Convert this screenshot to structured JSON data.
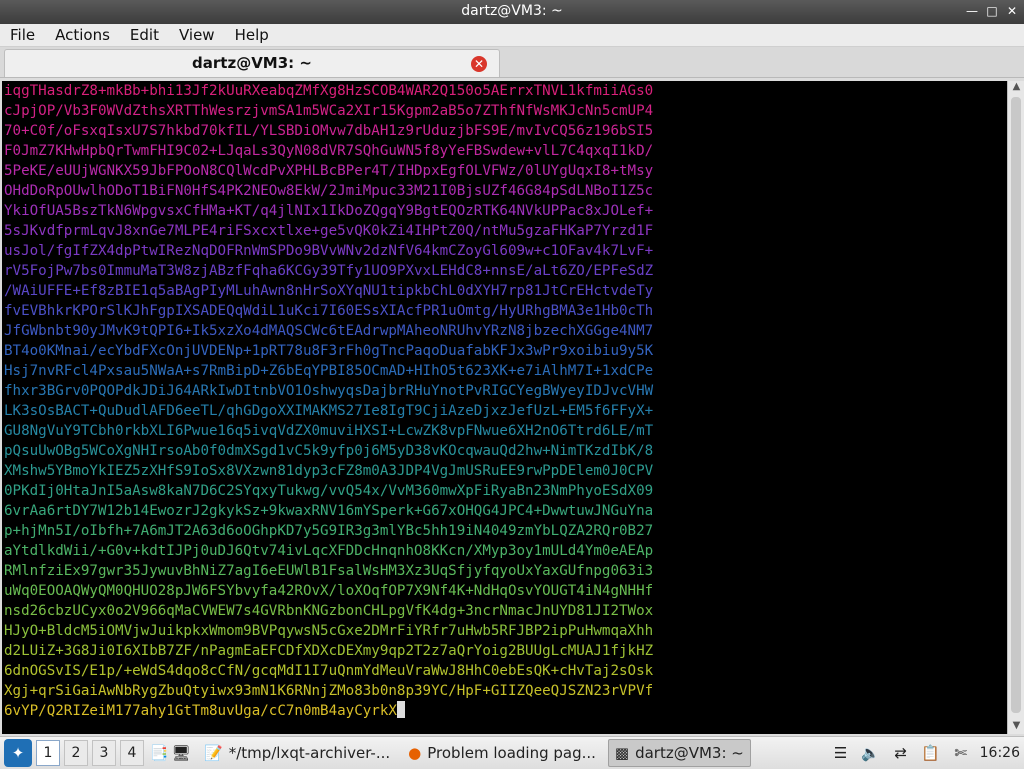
{
  "window": {
    "title": "dartz@VM3: ~"
  },
  "menu": [
    "File",
    "Actions",
    "Edit",
    "View",
    "Help"
  ],
  "tab": {
    "label": "dartz@VM3: ~"
  },
  "terminal": {
    "lines": [
      {
        "text": "iqgTHasdrZ8+mkBb+bhi13Jf2kUuRXeabqZMfXg8HzSCOB4WAR2Q150o5AErrxTNVL1kfmiiAGs0",
        "color": "#d9207a"
      },
      {
        "text": "cJpjOP/Vb3F0WVdZthsXRTThWesrzjvmSA1m5WCa2XIr15Kgpm2aB5o7ZThfNfWsMKJcNn5cmUP4",
        "color": "#d32287"
      },
      {
        "text": "70+C0f/oFsxqIsxU7S7hkbd70kfIL/YLSBDiOMvw7dbAH1z9rUduzjbFS9E/mvIvCQ56z196bSI5",
        "color": "#cc2493"
      },
      {
        "text": "F0JmZ7KHwHpbQrTwmFHI9C02+LJqaLs3QyN08dVR7SQhGuWN5f8yYeFBSwdew+vlL7C4qxqI1kD/",
        "color": "#c3279f"
      },
      {
        "text": "5PeKE/eUUjWGNKX59JbFPOoN8CQlWcdPvXPHLBcBPer4T/IHDpxEgfOLVFWz/0lUYgUqxI8+tMsy",
        "color": "#b82aaa"
      },
      {
        "text": "OHdDoRpOUwlhODoT1BiFN0HfS4PK2NEOw8EkW/2JmiMpuc33M21I0BjsUZf46G84pSdLNBoI1Z5c",
        "color": "#ab2db3"
      },
      {
        "text": "YkiOfUA5BszTkN6WpgvsxCfHMa+KT/q4jlNIx1IkDoZQgqY9BgtEQOzRTK64NVkUPPac8xJOLef+",
        "color": "#9c31bb"
      },
      {
        "text": "5sJKvdfprmLqvJ8xnGe7MLPE4riFSxcxtlxe+ge5vQK0kZi4IHPtZ0Q/ntMu5gzaFHKaP7Yrzd1F",
        "color": "#8c35c1"
      },
      {
        "text": "usJol/fgIfZX4dpPtwIRezNqDOFRnWmSPDo9BVvWNv2dzNfV64kmCZoyGl609w+c1OFav4k7LvF+",
        "color": "#7b3ac5"
      },
      {
        "text": "rV5FojPw7bs0ImmuMaT3W8zjABzfFqha6KCGy39Tfy1UO9PXvxLEHdC8+nnsE/aLt6ZO/EPFeSdZ",
        "color": "#6a40c7"
      },
      {
        "text": "/WAiUFFE+Ef8zBIE1q5aBAgPIyMLuhAwn8nHrSoXYqNU1tipkbChL0dXYH7rp81JtCrEHctvdeTy",
        "color": "#5a47c8"
      },
      {
        "text": "fvEVBhkrKPOrSlKJhFgpIXSADEQqWdiL1uKci7I60ESsXIAcfPR1uOmtg/HyURhgBMA3e1Hb0cTh",
        "color": "#4b50c7"
      },
      {
        "text": "JfGWbnbt90yJMvK9tQPI6+Ik5xzXo4dMAQSCWc6tEAdrwpMAheoNRUhvYRzN8jbzechXGGge4NM7",
        "color": "#3e59c4"
      },
      {
        "text": "BT4o0KMnai/ecYbdFXcOnjUVDENp+1pRT78u8F3rFh0gTncPaqoDuafabKFJx3wPr9xoibiu9y5K",
        "color": "#3363c0"
      },
      {
        "text": "Hsj7nvRFcl4Pxsau5NWaA+s7RmBipD+Z6bEqYPBI85OCmAD+HIhO5t623XK+e7iAlhM7I+1xdCPe",
        "color": "#2b6dba"
      },
      {
        "text": "fhxr3BGrv0PQOPdkJDiJ64ARkIwDItnbVO1OshwyqsDajbrRHuYnotPvRIGCYegBWyeyIDJvcVHW",
        "color": "#2777b3"
      },
      {
        "text": "LK3sOsBACT+QuDudlAFD6eeTL/qhGDgoXXIMAKMS27Ie8IgT9CjiAzeDjxzJefUzL+EM5f6FFyX+",
        "color": "#2580ab"
      },
      {
        "text": "GU8NgVuY9TCbh0rkbXLI6Pwue16q5ivqVdZX0muviHXSI+LcwZK8vpFNwue6XH2nO6Ttrd6LE/mT",
        "color": "#2689a3"
      },
      {
        "text": "pQsuUwOBg5WCoXgNHIrsoAb0f0dmXSgd1vC5k9yfp0j6M5yD38vKOcqwauQd2hw+NimTKzdIbK/8",
        "color": "#28929a"
      },
      {
        "text": "XMshw5YBmoYkIEZ5zXHfS9IoSx8VXzwn81dyp3cFZ8m0A3JDP4VgJmUSRuEE9rwPpDElem0J0CPV",
        "color": "#2c9a91"
      },
      {
        "text": "0PKdIj0HtaJnI5aAsw8kaN7D6C2SYqxyTukwg/vvQ54x/VvM360mwXpFiRyaBn23NmPhyoESdX09",
        "color": "#31a187"
      },
      {
        "text": "6vrAa6rtDY7W12b14EwozrJ2gkykSz+9kwaxRNV16mYSperk+G67xOHQG4JPC4+DwwtuwJNGuYna",
        "color": "#38a87d"
      },
      {
        "text": "p+hjMn5I/oIbfh+7A6mJT2A63d6oOGhpKD7y5G9IR3g3mlYBc5hh19iN4049zmYbLQZA2RQr0B27",
        "color": "#41ae73"
      },
      {
        "text": "aYtdlkdWii/+G0v+kdtIJPj0uDJ6Qtv74ivLqcXFDDcHnqnhO8KKcn/XMyp3oy1mULd4Ym0eAEAp",
        "color": "#4cb368"
      },
      {
        "text": "RMlnfziEx97gwr35JywuvBhNiZ7agI6eEUWlB1FsalWsHM3Xz3UqSfjyfqyoUxYaxGUfnpg063i3",
        "color": "#59b85d"
      },
      {
        "text": "uWq0EOOAQWyQM0QHUO28pJW6FSYbvyfa42ROvX/loXOqfOP7X9Nf4K+NdHqOsvYOUGT4iN4gNHHf",
        "color": "#68bc52"
      },
      {
        "text": "nsd26cbzUCyx0o2V966qMaCVWEW7s4GVRbnKNGzbonCHLpgVfK4dg+3ncrNmacJnUYD81JI2TWox",
        "color": "#79bf47"
      },
      {
        "text": "HJyO+BldcM5iOMVjwJuikpkxWmom9BVPqywsN5cGxe2DMrFiYRfr7uHwb5RFJBP2ipPuHwmqaXhh",
        "color": "#8bc13d"
      },
      {
        "text": "d2LUiZ+3G8Ji0I6XIbB7ZF/nPagmEaEFCDfXDXcDEXmy9qp2T2z7aQrYoig2BUUgLcMUAJ1fjkHZ",
        "color": "#9ec235"
      },
      {
        "text": "6dnOGSvIS/E1p/+eWdS4dqo8cCfN/gcqMdI1I7uQnmYdMeuVraWwJ8HhC0ebEsQK+cHvTaj2sOsk",
        "color": "#b2c22e"
      },
      {
        "text": "Xgj+qrSiGaiAwNbRygZbuQtyiwx93mN1K6RNnjZMo83b0n8p39YC/HpF+GIIZQeeQJSZN23rVPVf",
        "color": "#c6c12a"
      },
      {
        "text": "6vYP/Q2RIZeiM177ahy1GtTm8uvUga/cC7n0mB4ayCyrkX",
        "color": "#d9bf28"
      }
    ]
  },
  "taskbar": {
    "workspaces": [
      "1",
      "2",
      "3",
      "4"
    ],
    "tasks": [
      {
        "label": "*/tmp/lxqt-archiver-..."
      },
      {
        "label": "Problem loading pag..."
      },
      {
        "label": "dartz@VM3: ~"
      }
    ],
    "clock": "16:26"
  },
  "colors": {
    "terminal_bg": "#000000",
    "close_button": "#d9362b"
  }
}
